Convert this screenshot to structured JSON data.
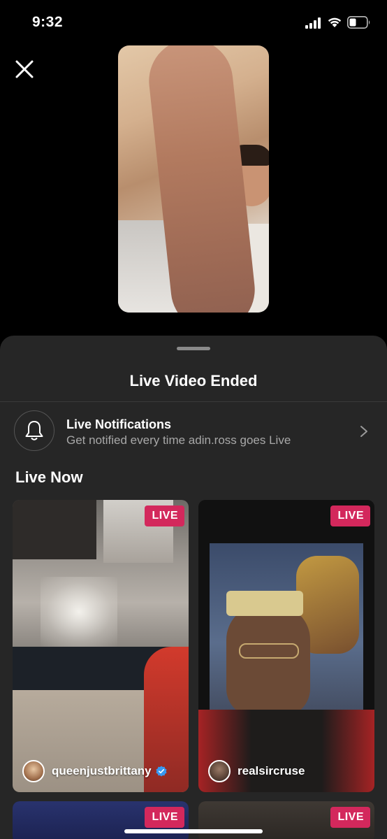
{
  "status_bar": {
    "time": "9:32",
    "icons": [
      "signal-icon",
      "wifi-icon",
      "battery-icon"
    ]
  },
  "top": {
    "close_icon": "close-icon"
  },
  "sheet": {
    "title": "Live Video Ended",
    "notification": {
      "title": "Live Notifications",
      "subtitle": "Get notified every time adin.ross goes Live",
      "icon": "bell-icon"
    },
    "section_title": "Live Now",
    "live_cards": [
      {
        "badge": "LIVE",
        "username": "queenjustbrittany",
        "verified": true
      },
      {
        "badge": "LIVE",
        "username": "realsircruse",
        "verified": false
      },
      {
        "badge": "LIVE"
      },
      {
        "badge": "LIVE"
      }
    ]
  },
  "colors": {
    "live_badge": "#d3285c",
    "sheet_background": "#262626",
    "verified": "#3897f0"
  }
}
